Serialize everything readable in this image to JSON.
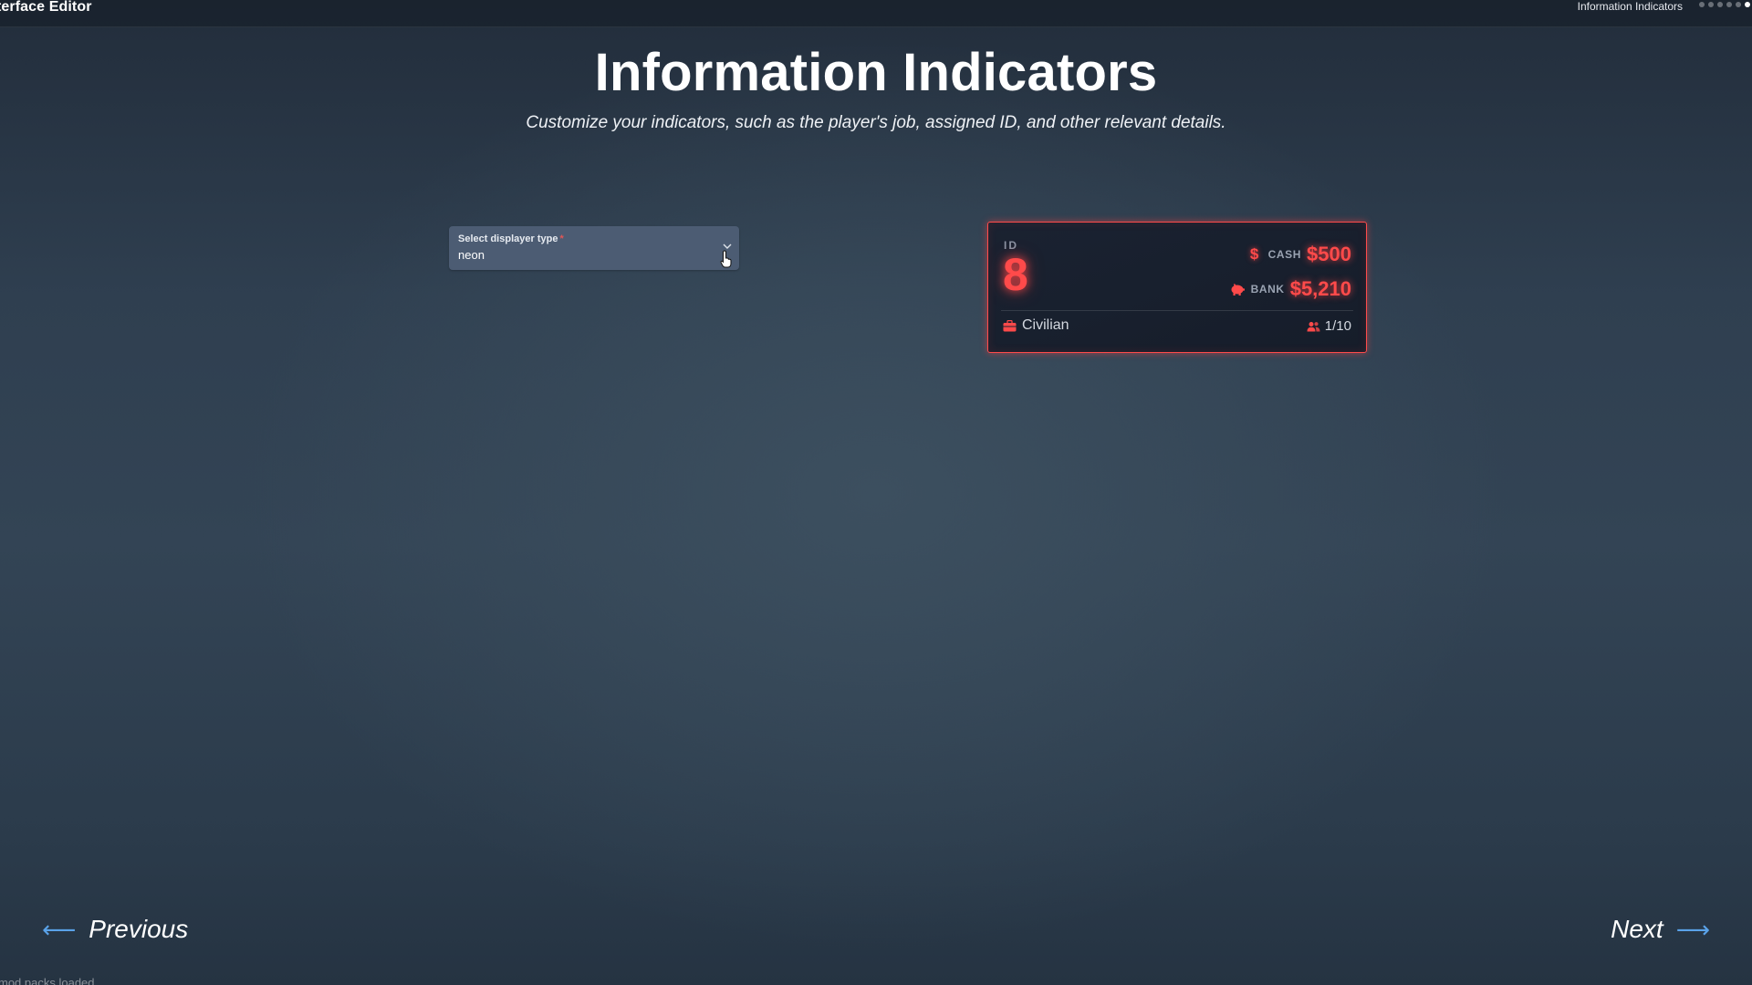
{
  "topbar": {
    "app_title": "terface Editor",
    "breadcrumb": "Information Indicators"
  },
  "header": {
    "title": "Information Indicators",
    "subtitle": "Customize your indicators, such as the player's job, assigned ID, and other relevant details."
  },
  "displayer_select": {
    "label": "Select displayer type",
    "required_mark": "*",
    "value": "neon"
  },
  "preview_card": {
    "style": "neon",
    "accent_color": "#ff4a4a",
    "id_label": "ID",
    "id_value": "8",
    "cash": {
      "icon": "dollar-icon",
      "label": "CASH",
      "value": "$500"
    },
    "bank": {
      "icon": "piggy-bank-icon",
      "label": "BANK",
      "value": "$5,210"
    },
    "job": {
      "icon": "briefcase-icon",
      "value": "Civilian"
    },
    "players": {
      "icon": "users-icon",
      "value": "1/10"
    }
  },
  "navigation": {
    "previous_label": "Previous",
    "next_label": "Next",
    "arrow_color": "#5aa2e8"
  },
  "footer": {
    "status_text": "mod packs loaded"
  }
}
